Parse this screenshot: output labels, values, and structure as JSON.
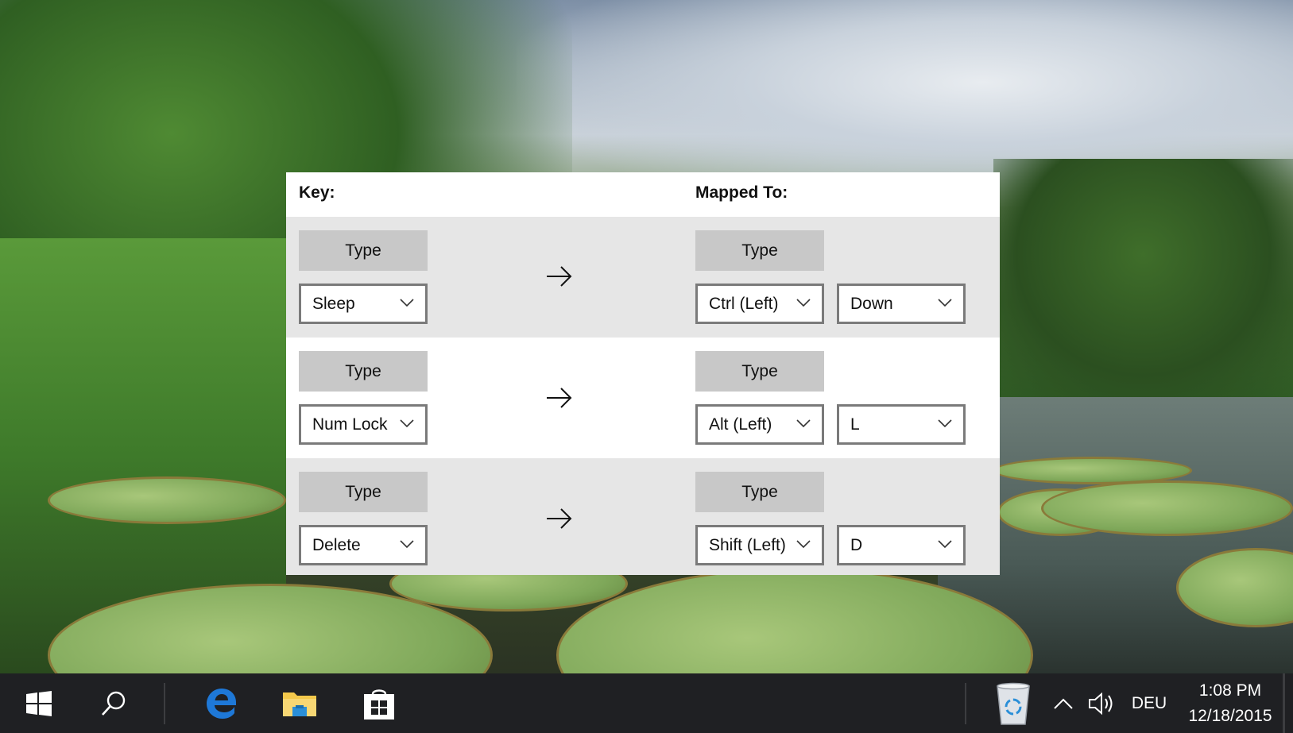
{
  "mapping": {
    "key_header": "Key:",
    "mapped_header": "Mapped To:",
    "rows": [
      {
        "type_label": "Type",
        "key": "Sleep",
        "mapped_type_label": "Type",
        "modifier": "Ctrl (Left)",
        "mapped_key": "Down"
      },
      {
        "type_label": "Type",
        "key": "Num Lock",
        "mapped_type_label": "Type",
        "modifier": "Alt (Left)",
        "mapped_key": "L"
      },
      {
        "type_label": "Type",
        "key": "Delete",
        "mapped_type_label": "Type",
        "modifier": "Shift (Left)",
        "mapped_key": "D"
      }
    ]
  },
  "taskbar": {
    "start_icon": "windows-start-icon",
    "search_icon": "search-icon",
    "pinned": [
      "edge-browser-icon",
      "file-explorer-icon",
      "store-icon"
    ],
    "tray": {
      "recycle_bin_icon": "recycle-bin-icon",
      "overflow_icon": "chevron-up-icon",
      "volume_icon": "volume-icon",
      "language": "DEU",
      "time": "1:08 PM",
      "date": "12/18/2015"
    }
  },
  "colors": {
    "row_shaded": "#e6e6e6",
    "type_button": "#c8c8c8",
    "combo_border": "#7a7a7a",
    "taskbar": "#1f2023",
    "edge_blue": "#1e78d7",
    "folder_yellow": "#f3c84b"
  }
}
